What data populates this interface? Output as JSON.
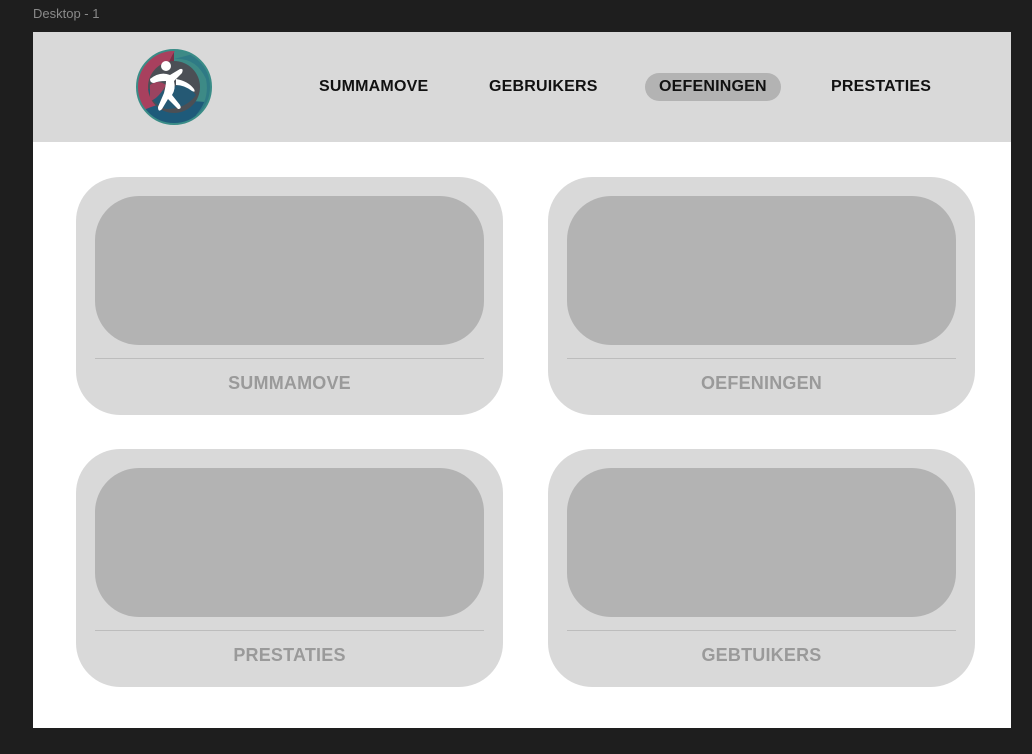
{
  "frame": {
    "label": "Desktop - 1"
  },
  "header": {
    "logo_icon": "runner-logo-icon",
    "nav": [
      {
        "label": "SUMMAMOVE",
        "active": false
      },
      {
        "label": "GEBRUIKERS",
        "active": false
      },
      {
        "label": "OEFENINGEN",
        "active": true
      },
      {
        "label": "PRESTATIES",
        "active": false
      }
    ]
  },
  "cards": [
    {
      "title": "SUMMAMOVE"
    },
    {
      "title": "OEFENINGEN"
    },
    {
      "title": "PRESTATIES"
    },
    {
      "title": "GEBTUIKERS"
    }
  ],
  "colors": {
    "canvas": "#1e1e1e",
    "header_bg": "#d9d9d9",
    "card_bg": "#d9d9d9",
    "card_image": "#b3b3b3",
    "active_nav_bg": "#b3b3b3",
    "card_title": "#9a9a9a"
  }
}
